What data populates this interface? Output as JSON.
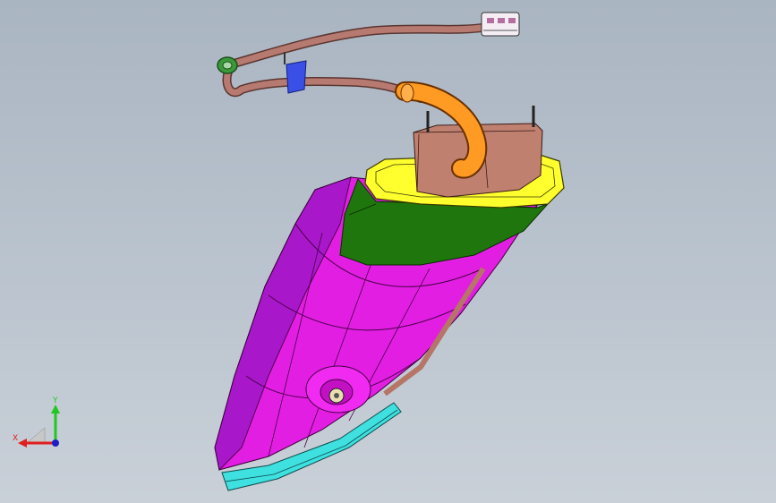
{
  "viewport": {
    "background_top": "#aab5c2",
    "background_bottom": "#c9d0d8"
  },
  "model": {
    "parts": [
      {
        "name": "housing",
        "color": "#e400e4"
      },
      {
        "name": "collar",
        "color": "#1e6e0a"
      },
      {
        "name": "rim",
        "color": "#ffff2a"
      },
      {
        "name": "mount-block",
        "color": "#b57567"
      },
      {
        "name": "tube",
        "color": "#ff9a1e"
      },
      {
        "name": "harness",
        "color": "#a8665c"
      },
      {
        "name": "lens",
        "color": "#35dcdc"
      },
      {
        "name": "clip",
        "color": "#2a3fd6"
      },
      {
        "name": "grommet",
        "color": "#2e8a2e"
      },
      {
        "name": "connector",
        "color": "#f0e8f0"
      }
    ]
  },
  "triad": {
    "x_label": "X",
    "y_label": "Y",
    "x_color": "#e01e1e",
    "y_color": "#1ec81e",
    "z_color": "#1e1ec8"
  }
}
